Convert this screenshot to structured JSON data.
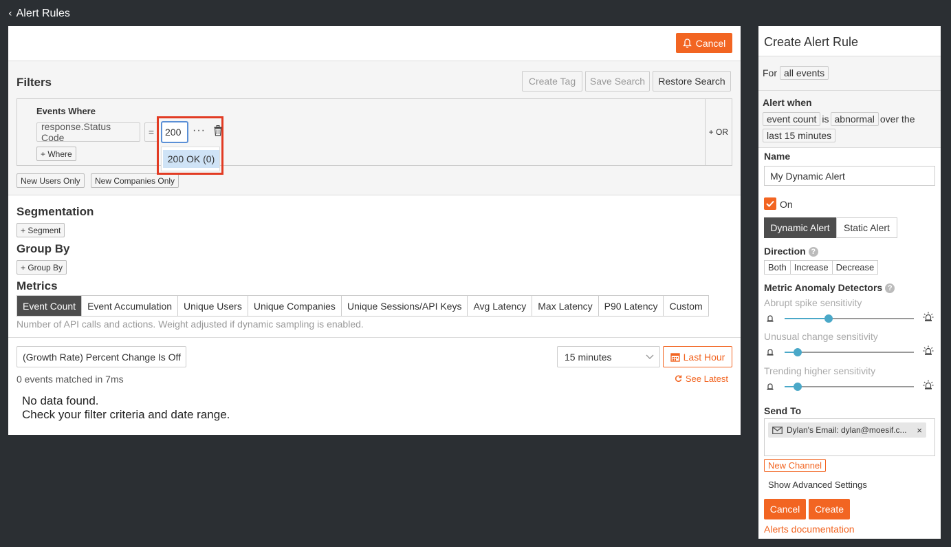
{
  "breadcrumb": {
    "label": "Alert Rules"
  },
  "main": {
    "cancel_label": "Cancel",
    "filters": {
      "title": "Filters",
      "create_tag": "Create Tag",
      "save_search": "Save Search",
      "restore_search": "Restore Search",
      "events_where": "Events Where",
      "field": "response.Status Code",
      "operator": "=",
      "value": "200",
      "more": "···",
      "suggestion": "200 OK (0)",
      "add_where": "+ Where",
      "or": "+ OR",
      "new_users_only": "New Users Only",
      "new_companies_only": "New Companies Only"
    },
    "segmentation": {
      "title": "Segmentation",
      "add": "+ Segment"
    },
    "group_by": {
      "title": "Group By",
      "add": "+ Group By"
    },
    "metrics": {
      "title": "Metrics",
      "tabs": [
        "Event Count",
        "Event Accumulation",
        "Unique Users",
        "Unique Companies",
        "Unique Sessions/API Keys",
        "Avg Latency",
        "Max Latency",
        "P90 Latency",
        "Custom"
      ],
      "selected": "Event Count",
      "hint": "Number of API calls and actions. Weight adjusted if dynamic sampling is enabled."
    },
    "results": {
      "growth": "(Growth Rate) Percent Change Is Off",
      "interval": "15 minutes",
      "last_hour": "Last Hour",
      "matched": "0 events matched in 7ms",
      "see_latest": "See Latest",
      "no_data_1": "No data found.",
      "no_data_2": "Check your filter criteria and date range."
    }
  },
  "side": {
    "title": "Create Alert Rule",
    "for_label": "For",
    "for_value": "all events",
    "alert_when": "Alert when",
    "metric": "event count",
    "is": "is",
    "condition": "abnormal",
    "over_the": "over the",
    "window": "last 15 minutes",
    "name_label": "Name",
    "name_value": "My Dynamic Alert",
    "on_label": "On",
    "dynamic_alert": "Dynamic Alert",
    "static_alert": "Static Alert",
    "direction_label": "Direction",
    "direction_options": [
      "Both",
      "Increase",
      "Decrease"
    ],
    "detectors_label": "Metric Anomaly Detectors",
    "sensitivities": [
      {
        "label": "Abrupt spike sensitivity",
        "level": 0.34
      },
      {
        "label": "Unusual change sensitivity",
        "level": 0.1
      },
      {
        "label": "Trending higher sensitivity",
        "level": 0.1
      }
    ],
    "send_to_label": "Send To",
    "email_chip": "Dylan's Email: dylan@moesif.c...",
    "email_remove": "×",
    "new_channel": "New Channel",
    "advanced": "Show Advanced Settings",
    "cancel": "Cancel",
    "create": "Create",
    "docs_link": "Alerts documentation"
  },
  "colors": {
    "accent": "#f26522",
    "slider": "#4aa8c8",
    "background": "#2b2f33",
    "highlight": "#e23b23"
  }
}
